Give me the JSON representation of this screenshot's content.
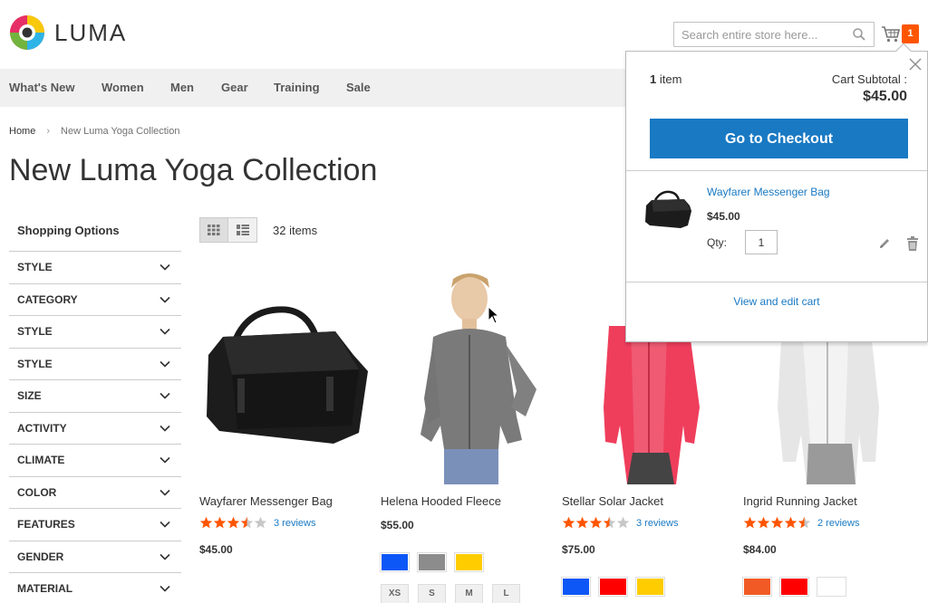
{
  "header": {
    "logo_text": "LUMA",
    "search_placeholder": "Search entire store here...",
    "cart_count": "1"
  },
  "nav": {
    "items": [
      "What's New",
      "Women",
      "Men",
      "Gear",
      "Training",
      "Sale"
    ]
  },
  "breadcrumb": {
    "home": "Home",
    "current": "New Luma Yoga Collection"
  },
  "page": {
    "title": "New Luma Yoga Collection"
  },
  "sidebar": {
    "heading": "Shopping Options",
    "filters": [
      "Style",
      "Category",
      "Style",
      "Style",
      "Size",
      "Activity",
      "Climate",
      "Color",
      "Features",
      "Gender",
      "Material"
    ]
  },
  "toolbar": {
    "count": "32 items",
    "modes": [
      "grid-icon",
      "list-icon"
    ]
  },
  "products": [
    {
      "name": "Wayfarer Messenger Bag",
      "rating": 3.5,
      "reviews": "3 reviews",
      "price": "$45.00"
    },
    {
      "name": "Helena Hooded Fleece",
      "price": "$55.00",
      "swatches": [
        "#0d57f7",
        "#8c8c8c",
        "#ffcc00"
      ],
      "sizes": [
        "XS",
        "S",
        "M",
        "L"
      ]
    },
    {
      "name": "Stellar Solar Jacket",
      "rating": 3.5,
      "reviews": "3 reviews",
      "price": "$75.00",
      "swatches": [
        "#0d57f7",
        "#ff0000",
        "#ffcc00"
      ]
    },
    {
      "name": "Ingrid Running Jacket",
      "rating": 4.5,
      "reviews": "2 reviews",
      "price": "$84.00",
      "swatches": [
        "#f15a24",
        "#ff0000",
        "#ffffff"
      ]
    }
  ],
  "minicart": {
    "items_count": "1",
    "items_label": "item",
    "subtotal_label": "Cart Subtotal :",
    "subtotal": "$45.00",
    "checkout_label": "Go to Checkout",
    "item": {
      "name": "Wayfarer Messenger Bag",
      "price": "$45.00",
      "qty_label": "Qty:",
      "qty": "1"
    },
    "view_cart_label": "View and edit cart"
  },
  "colors": {
    "accent": "#1979c3",
    "cart_badge": "#ff5501",
    "star": "#ff5501",
    "nav_bg": "#f0f0f0"
  }
}
